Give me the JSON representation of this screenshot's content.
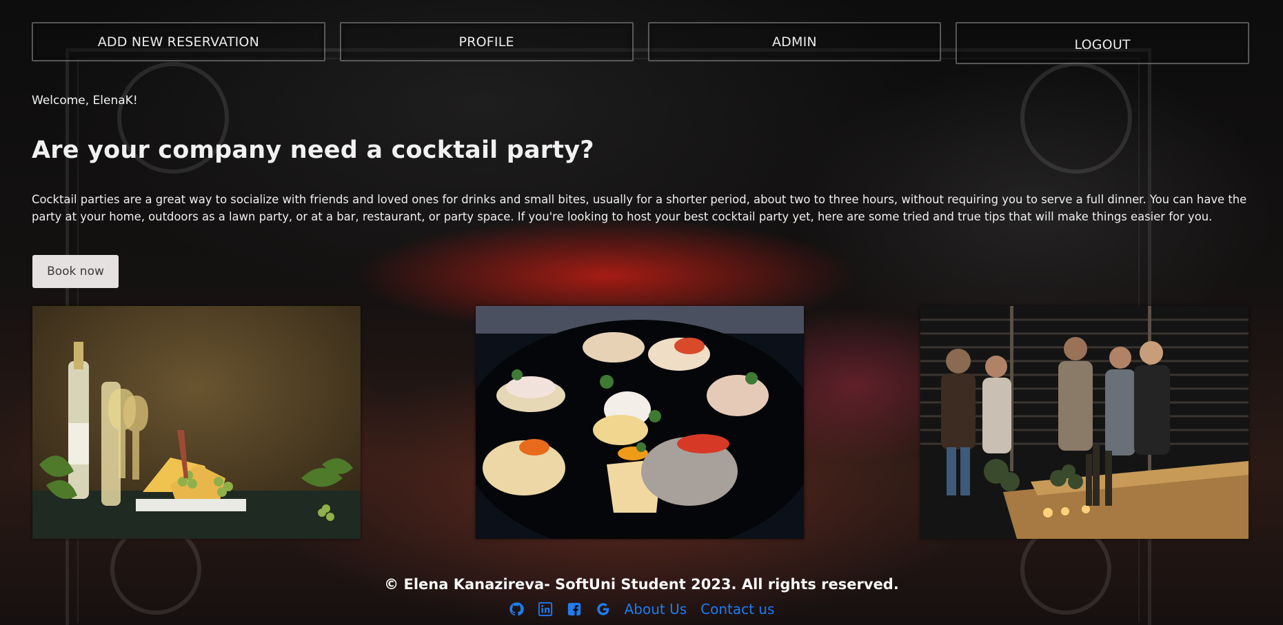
{
  "nav": {
    "items": [
      {
        "label": "ADD NEW RESERVATION"
      },
      {
        "label": "PROFILE"
      },
      {
        "label": "ADMIN"
      },
      {
        "label": "LOGOUT"
      }
    ]
  },
  "main": {
    "welcome": "Welcome, ElenaK!",
    "headline": "Are your company need a cocktail party?",
    "description": "Cocktail parties are a great way to socialize with friends and loved ones for drinks and small bites, usually for a shorter period, about two to three hours, without requiring you to serve a full dinner. You can have the party at your home, outdoors as a lawn party, or at a bar, restaurant, or party space. If you're looking to host your best cocktail party yet, here are some tried and true tips that will make things easier for you.",
    "book_button": "Book now"
  },
  "gallery": [
    {
      "icon": "wine-cheese-photo"
    },
    {
      "icon": "canapes-photo"
    },
    {
      "icon": "party-guests-photo"
    }
  ],
  "footer": {
    "copyright": "© Elena Kanazireva- SoftUni Student 2023. All rights reserved.",
    "icons": [
      "github-icon",
      "linkedin-icon",
      "facebook-icon",
      "google-icon"
    ],
    "links": [
      {
        "label": "About Us"
      },
      {
        "label": "Contact us"
      }
    ]
  },
  "colors": {
    "link": "#1f7cf2",
    "button_bg": "#e6e1e1",
    "text": "#f2f2f2"
  }
}
